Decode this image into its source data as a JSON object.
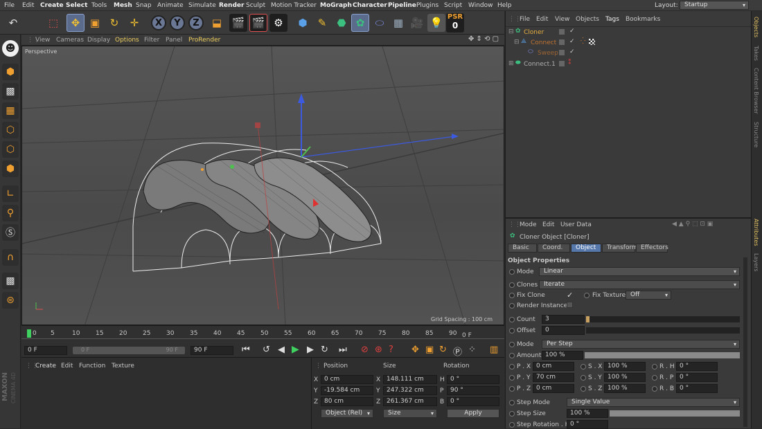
{
  "layout_label": "Layout:",
  "layout_value": "Startup",
  "menus": [
    "File",
    "Edit",
    "Create",
    "Select",
    "Tools",
    "Mesh",
    "Snap",
    "Animate",
    "Simulate",
    "Render",
    "Sculpt",
    "Motion Tracker",
    "MoGraph",
    "Character",
    "Pipeline",
    "Plugins",
    "Script",
    "Window",
    "Help"
  ],
  "psr": {
    "label": "PSR",
    "value": "0"
  },
  "viewport_menu": [
    "View",
    "Cameras",
    "Display",
    "Options",
    "Filter",
    "Panel",
    "ProRender"
  ],
  "viewport": {
    "camera": "Perspective",
    "grid_spacing": "Grid Spacing : 100 cm"
  },
  "timeline": {
    "ticks": [
      "0",
      "5",
      "10",
      "15",
      "20",
      "25",
      "30",
      "35",
      "40",
      "45",
      "50",
      "55",
      "60",
      "65",
      "70",
      "75",
      "80",
      "85",
      "90"
    ],
    "current": "0 F",
    "start": "0 F",
    "range_left": "0 F",
    "range_right": "90 F",
    "end": "90 F"
  },
  "material_menu": [
    "Create",
    "Edit",
    "Function",
    "Texture"
  ],
  "coords": {
    "headers": {
      "position": "Position",
      "size": "Size",
      "rotation": "Rotation"
    },
    "rows": [
      {
        "pl": "X",
        "pv": "0 cm",
        "sl": "X",
        "sv": "148.111 cm",
        "rl": "H",
        "rv": "0 °"
      },
      {
        "pl": "Y",
        "pv": "-19.584 cm",
        "sl": "Y",
        "sv": "247.322 cm",
        "rl": "P",
        "rv": "90 °"
      },
      {
        "pl": "Z",
        "pv": "80 cm",
        "sl": "Z",
        "sv": "261.367 cm",
        "rl": "B",
        "rv": "0 °"
      }
    ],
    "mode1": "Object (Rel)",
    "mode2": "Size",
    "apply": "Apply"
  },
  "object_menu": [
    "File",
    "Edit",
    "View",
    "Objects",
    "Tags",
    "Bookmarks"
  ],
  "objects": [
    {
      "name": "Cloner",
      "color": "#e8b040"
    },
    {
      "name": "Connect",
      "color": "#e08030"
    },
    {
      "name": "Sweep",
      "color": "#e08030"
    },
    {
      "name": "Connect.1",
      "color": "#b0b0b0"
    }
  ],
  "attr_menu": [
    "Mode",
    "Edit",
    "User Data"
  ],
  "attr_title": "Cloner Object [Cloner]",
  "attr_tabs": [
    "Basic",
    "Coord.",
    "Object",
    "Transform",
    "Effectors"
  ],
  "section": "Object Properties",
  "props": {
    "mode_label": "Mode",
    "mode_value": "Linear",
    "clones_label": "Clones",
    "clones_value": "Iterate",
    "fix_clone_label": "Fix Clone",
    "fix_clone_check": "✓",
    "fix_texture_label": "Fix Texture",
    "fix_texture_value": "Off",
    "render_instances_label": "Render Instances",
    "count_label": "Count",
    "count_value": "3",
    "offset_label": "Offset",
    "offset_value": "0",
    "mode2_label": "Mode",
    "mode2_value": "Per Step",
    "amount_label": "Amount",
    "amount_value": "100 %",
    "px_label": "P . X",
    "px": "0 cm",
    "sx_label": "S . X",
    "sx": "100 %",
    "rh_label": "R . H",
    "rh": "0 °",
    "py_label": "P . Y",
    "py": "70 cm",
    "sy_label": "S . Y",
    "sy": "100 %",
    "rp_label": "R . P",
    "rp": "0 °",
    "pz_label": "P . Z",
    "pz": "0 cm",
    "sz_label": "S . Z",
    "sz": "100 %",
    "rb_label": "R . B",
    "rb": "0 °",
    "step_mode_label": "Step Mode",
    "step_mode_value": "Single Value",
    "step_size_label": "Step Size",
    "step_size_value": "100 %",
    "step_rotation_label": "Step Rotation . H",
    "step_rotation_value": "0 °"
  },
  "right_tabs": [
    "Objects",
    "Takes",
    "Content Browser",
    "Structure",
    "Attributes",
    "Layers"
  ],
  "brand": {
    "maxon": "MAXON",
    "product": "CINEMA 4D"
  }
}
